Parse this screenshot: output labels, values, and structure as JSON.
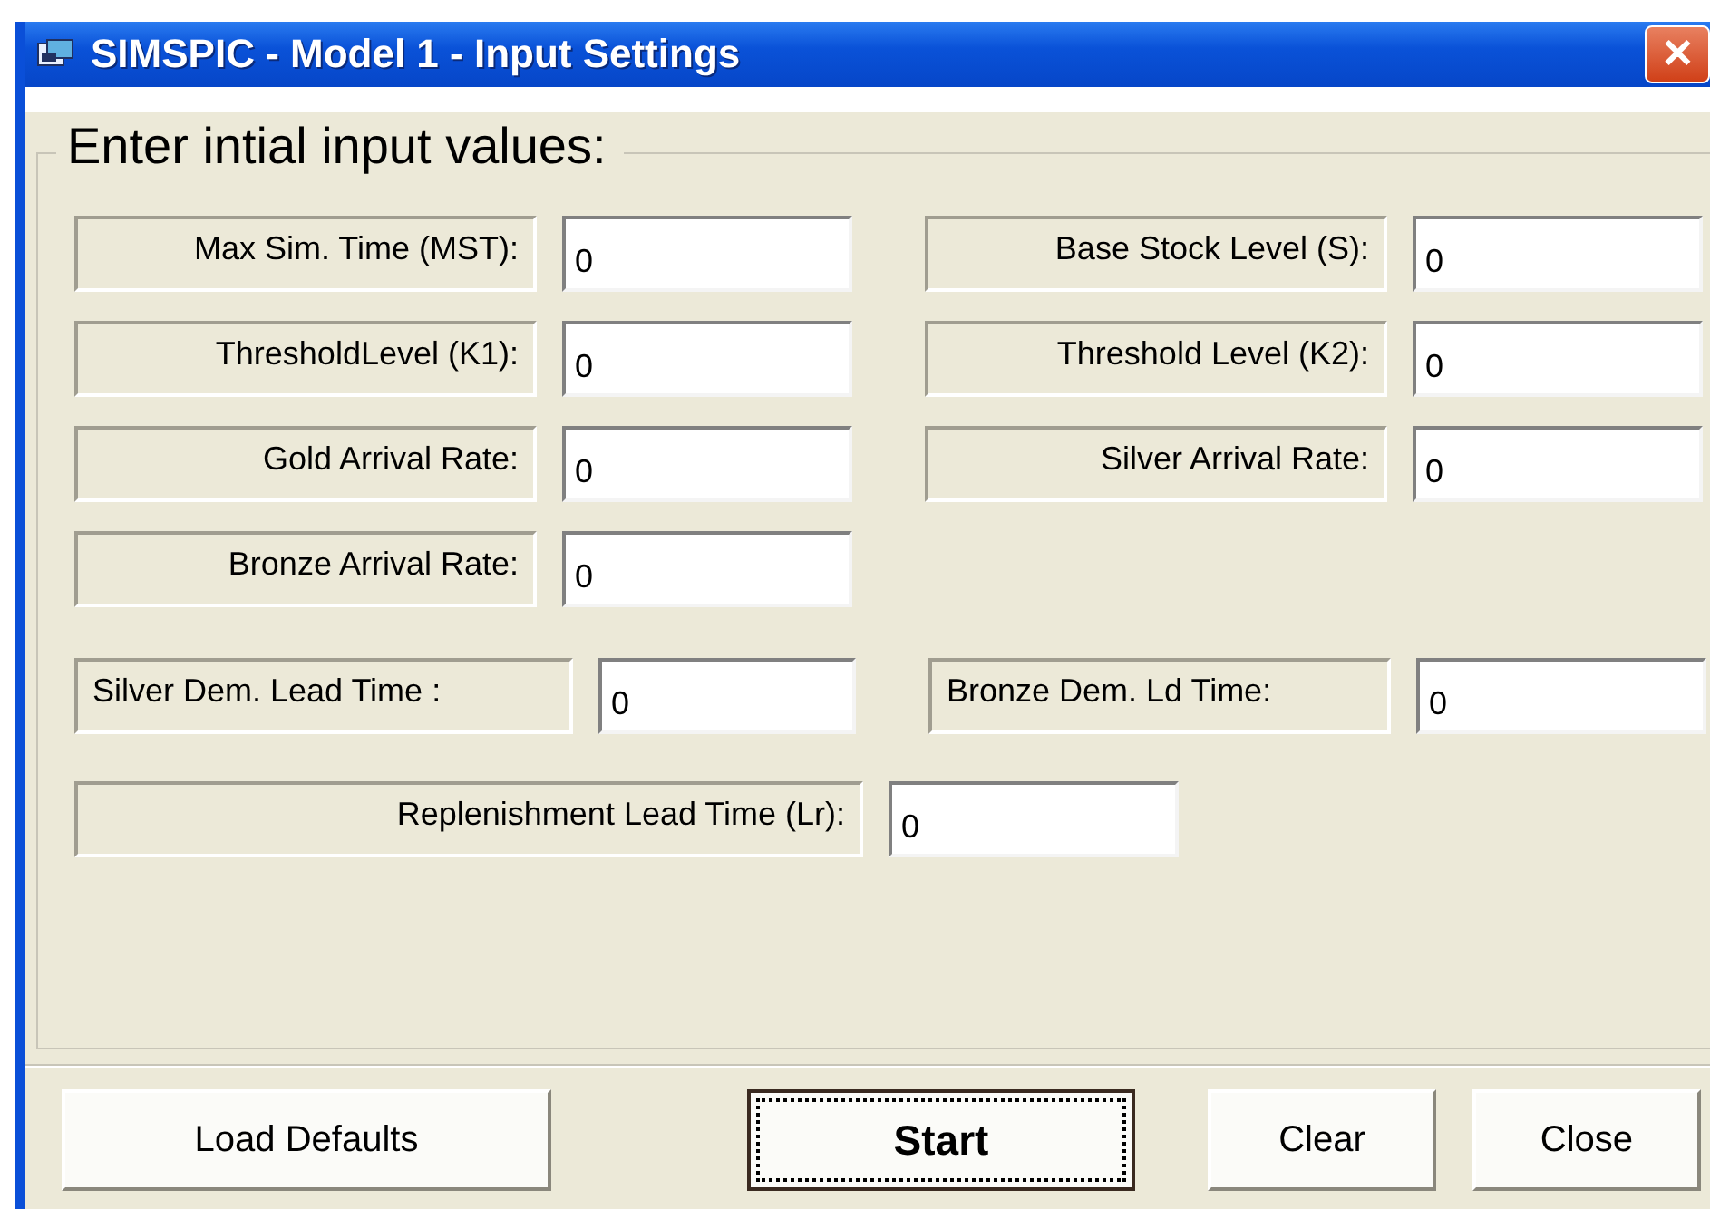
{
  "window": {
    "title": "SIMSPIC - Model 1 - Input Settings",
    "close_label": "✕"
  },
  "group": {
    "title": "Enter intial input values:"
  },
  "rows": [
    [
      {
        "label": "Max Sim. Time (MST):",
        "value": "0"
      },
      {
        "label": "Base Stock Level (S):",
        "value": "0"
      }
    ],
    [
      {
        "label": "ThresholdLevel (K1):",
        "value": "0"
      },
      {
        "label": "Threshold Level (K2):",
        "value": "0"
      }
    ],
    [
      {
        "label": "Gold Arrival Rate:",
        "value": "0"
      },
      {
        "label": "Silver Arrival Rate:",
        "value": "0"
      }
    ],
    [
      {
        "label": "Bronze Arrival Rate:",
        "value": "0"
      }
    ],
    [
      {
        "label": "Silver Dem. Lead Time :",
        "value": "0"
      },
      {
        "label": "Bronze Dem. Ld Time:",
        "value": "0"
      }
    ],
    [
      {
        "label": "Replenishment Lead Time (Lr):",
        "value": "0"
      }
    ]
  ],
  "buttons": [
    {
      "label": "Load Defaults",
      "default": false
    },
    {
      "label": "Start",
      "default": true
    },
    {
      "label": "Clear",
      "default": false
    },
    {
      "label": "Close",
      "default": false
    }
  ]
}
